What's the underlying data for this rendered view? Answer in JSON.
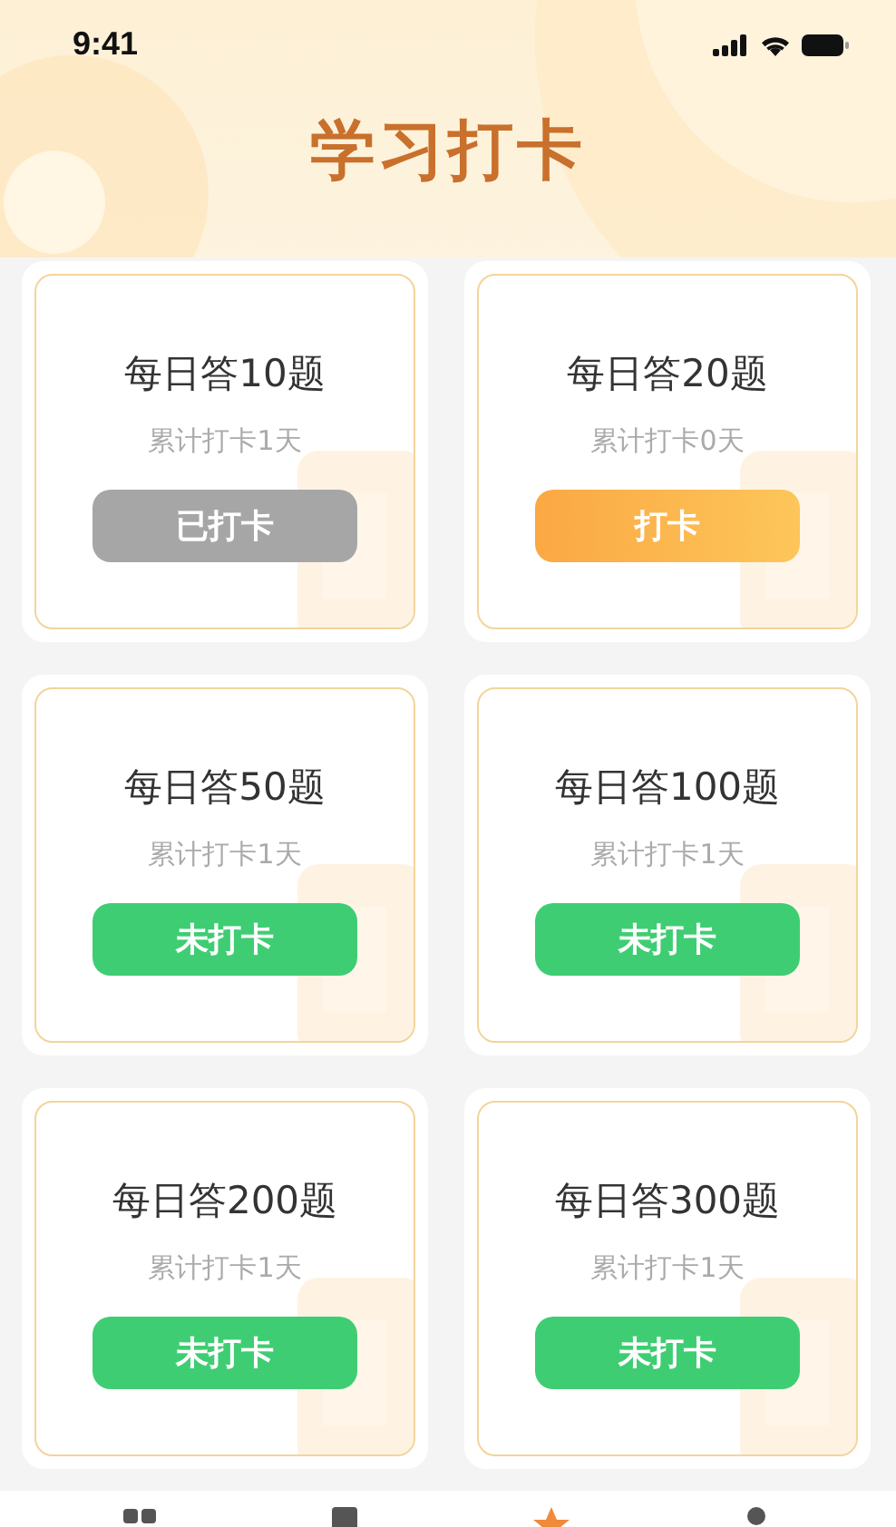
{
  "status_bar": {
    "time": "9:41"
  },
  "title": "学习打卡",
  "cards": [
    {
      "title": "每日答10题",
      "subtitle": "累计打卡1天",
      "button": {
        "label": "已打卡",
        "kind": "done"
      }
    },
    {
      "title": "每日答20题",
      "subtitle": "累计打卡0天",
      "button": {
        "label": "打卡",
        "kind": "checkin"
      }
    },
    {
      "title": "每日答50题",
      "subtitle": "累计打卡1天",
      "button": {
        "label": "未打卡",
        "kind": "pending"
      }
    },
    {
      "title": "每日答100题",
      "subtitle": "累计打卡1天",
      "button": {
        "label": "未打卡",
        "kind": "pending"
      }
    },
    {
      "title": "每日答200题",
      "subtitle": "累计打卡1天",
      "button": {
        "label": "未打卡",
        "kind": "pending"
      }
    },
    {
      "title": "每日答300题",
      "subtitle": "累计打卡1天",
      "button": {
        "label": "未打卡",
        "kind": "pending"
      }
    }
  ],
  "tab_bar": [
    {
      "selected": false
    },
    {
      "selected": false
    },
    {
      "selected": true
    },
    {
      "selected": false
    }
  ]
}
